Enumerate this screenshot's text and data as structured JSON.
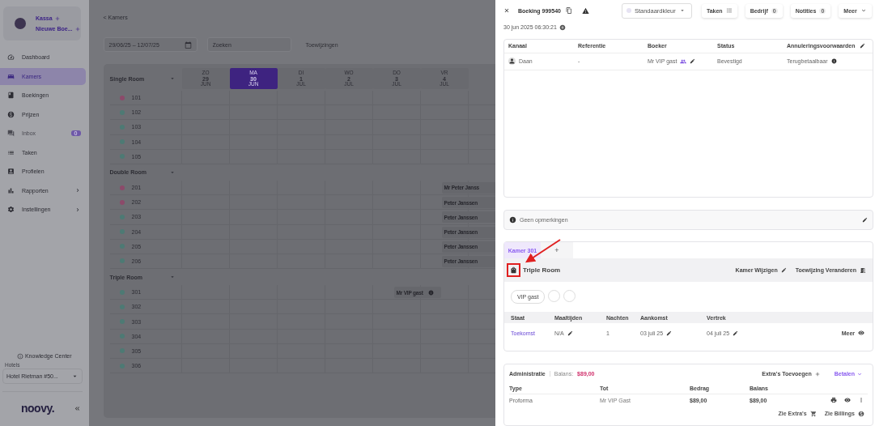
{
  "sidebar": {
    "shortcuts": [
      "Kassa",
      "Nieuwe Boe..."
    ],
    "nav": [
      {
        "label": "Dashboard",
        "kind": "link",
        "selected": false,
        "disabled": false
      },
      {
        "label": "Kamers",
        "kind": "link",
        "selected": true,
        "disabled": false
      },
      {
        "label": "Boekingen",
        "kind": "link",
        "selected": false,
        "disabled": false
      },
      {
        "label": "Prijzen",
        "kind": "link",
        "selected": false,
        "disabled": false
      },
      {
        "label": "Inbox",
        "kind": "link",
        "selected": false,
        "disabled": true,
        "badge": "0"
      },
      {
        "label": "Taken",
        "kind": "link",
        "selected": false,
        "disabled": false
      },
      {
        "label": "Profielen",
        "kind": "link",
        "selected": false,
        "disabled": false
      },
      {
        "label": "Rapporten",
        "kind": "submenu",
        "selected": false,
        "disabled": false
      },
      {
        "label": "Instellingen",
        "kind": "submenu",
        "selected": false,
        "disabled": false
      }
    ],
    "help_link": "Knowledge Center",
    "hotel_select": {
      "label": "Hotels",
      "value": "Hotel Rietman #50..."
    },
    "logo": "noovy."
  },
  "calendar": {
    "back_link": "< Kamers",
    "date_range": "29/06/25 – 12/07/25",
    "search": {
      "placeholder": "Zoeken"
    },
    "assign_button": "Toewijzingen",
    "days": [
      {
        "weekday": "ZO",
        "day": "29",
        "month": "JUN",
        "selected": false
      },
      {
        "weekday": "MA",
        "day": "30",
        "month": "JUN",
        "selected": true
      },
      {
        "weekday": "DI",
        "day": "1",
        "month": "JUL",
        "selected": false
      },
      {
        "weekday": "WO",
        "day": "2",
        "month": "JUL",
        "selected": false
      },
      {
        "weekday": "DO",
        "day": "3",
        "month": "JUL",
        "selected": false
      },
      {
        "weekday": "VR",
        "day": "4",
        "month": "JUL",
        "selected": false
      }
    ],
    "room_types": [
      {
        "name": "Single Room",
        "rooms": [
          {
            "number": "101",
            "color": "#8c4a6a"
          },
          {
            "number": "102",
            "color": "#4d7a74"
          },
          {
            "number": "103",
            "color": "#4d7a74"
          },
          {
            "number": "104",
            "color": "#4d7a74"
          },
          {
            "number": "105",
            "color": "#4d7a74"
          }
        ]
      },
      {
        "name": "Double Room",
        "rooms": [
          {
            "number": "201",
            "color": "#8c4a6a",
            "booking": {
              "guest": "Mr Peter Janss",
              "kind": "plain"
            }
          },
          {
            "number": "202",
            "color": "#8c4a6a",
            "booking": {
              "guest": "Peter Janssen",
              "kind": "plain"
            }
          },
          {
            "number": "203",
            "color": "#4d7a74",
            "booking": {
              "guest": "Peter Janssen",
              "kind": "plain"
            }
          },
          {
            "number": "204",
            "color": "#4d7a74",
            "booking": {
              "guest": "Peter Janssen",
              "kind": "plain"
            }
          },
          {
            "number": "205",
            "color": "#4d7a74",
            "booking": {
              "guest": "Peter Janssen",
              "kind": "plain"
            }
          },
          {
            "number": "206",
            "color": "#4d7a74",
            "booking": {
              "guest": "Peter Janssen",
              "kind": "plain"
            }
          }
        ]
      },
      {
        "name": "Triple Room",
        "rooms": [
          {
            "number": "301",
            "color": "#4d7a74",
            "booking": {
              "guest": "Mr VIP gast",
              "kind": "vip"
            }
          },
          {
            "number": "302",
            "color": "#4d7a74"
          },
          {
            "number": "303",
            "color": "#4d7a74"
          },
          {
            "number": "304",
            "color": "#4d7a74"
          },
          {
            "number": "305",
            "color": "#4d7a74"
          },
          {
            "number": "306",
            "color": "#4d7a74"
          }
        ]
      }
    ]
  },
  "booking_panel": {
    "title": "Boeking 999540",
    "color_select": "Standaardkleur",
    "header_buttons": [
      {
        "label": "Taken",
        "kind": "icon"
      },
      {
        "label": "Bedrijf",
        "kind": "count",
        "count": "0"
      },
      {
        "label": "Notities",
        "kind": "count",
        "count": "0"
      },
      {
        "label": "Meer",
        "kind": "menu"
      }
    ],
    "created": "30 jun 2025 06:30:21",
    "summary": {
      "columns": [
        "Kanaal",
        "Referentie",
        "Boeker",
        "Status",
        "Annuleringsvoorwaarden"
      ],
      "row": {
        "channel": "Daan",
        "reference": "-",
        "booker": "Mr VIP gast",
        "status": "Bevestigd",
        "cancellation": "Terugbetaalbaar"
      }
    },
    "remarks": "Geen opmerkingen",
    "rooms": {
      "tabs": [
        {
          "label": "Kamer 301",
          "selected": true
        }
      ],
      "add_tab": "+",
      "room_type": "Triple Room",
      "actions": [
        "Kamer Wijzigen",
        "Toewijzing Veranderen"
      ],
      "guest_chips": [
        "VIP gast"
      ],
      "stay_columns": [
        "Staat",
        "Maaltijden",
        "Nachten",
        "Aankomst",
        "Vertrek"
      ],
      "stay_row": {
        "state": "Toekomst",
        "meals": "N/A",
        "nights": "1",
        "arrival": "03 juli 25",
        "departure": "04 juli 25",
        "more": "Meer"
      }
    },
    "administration": {
      "title": "Administratie",
      "balance_label": "Balans:",
      "balance": "$89,00",
      "add_extras": "Extra's Toevoegen",
      "pay": "Betalen",
      "columns": [
        "Type",
        "Tot",
        "Bedrag",
        "Balans"
      ],
      "rows": [
        {
          "type": "Proforma",
          "to": "Mr VIP Gast",
          "amount": "$89,00",
          "balance": "$89,00"
        }
      ],
      "links": [
        "Zie Extra's",
        "Zie Billings"
      ]
    }
  }
}
